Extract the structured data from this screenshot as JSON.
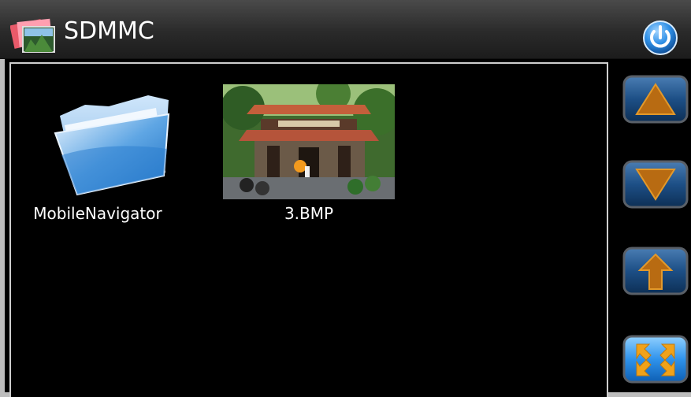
{
  "window": {
    "title": "SDMMC"
  },
  "files": [
    {
      "name": "MobileNavigator",
      "type": "folder"
    },
    {
      "name": "3.BMP",
      "type": "image"
    }
  ],
  "icons": {
    "app": "photos-icon",
    "power": "power-icon",
    "up": "arrow-up-icon",
    "down": "arrow-down-icon",
    "parent": "parent-folder-icon",
    "fullscreen": "fullscreen-icon"
  },
  "colors": {
    "accent_blue": "#1f76c8",
    "arrow_orange": "#e3992a",
    "background": "#000000"
  }
}
